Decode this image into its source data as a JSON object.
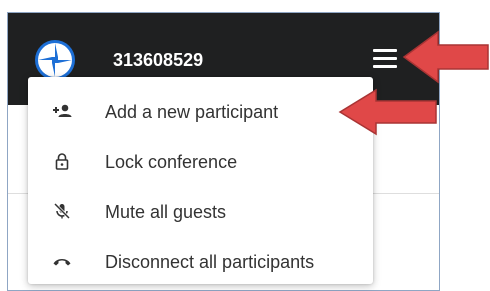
{
  "header": {
    "conference_id": "313608529",
    "logo_icon": "conference-logo-icon",
    "menu_icon": "hamburger-menu-icon"
  },
  "menu": {
    "items": [
      {
        "label": "Add a new participant",
        "icon": "add-participant-icon"
      },
      {
        "label": "Lock conference",
        "icon": "lock-icon"
      },
      {
        "label": "Mute all guests",
        "icon": "mute-icon"
      },
      {
        "label": "Disconnect all participants",
        "icon": "disconnect-icon"
      }
    ]
  },
  "colors": {
    "header_bg": "#1f2021",
    "logo_blue": "#1d6fd6",
    "arrow_red": "#e04848",
    "text": "#333333"
  }
}
